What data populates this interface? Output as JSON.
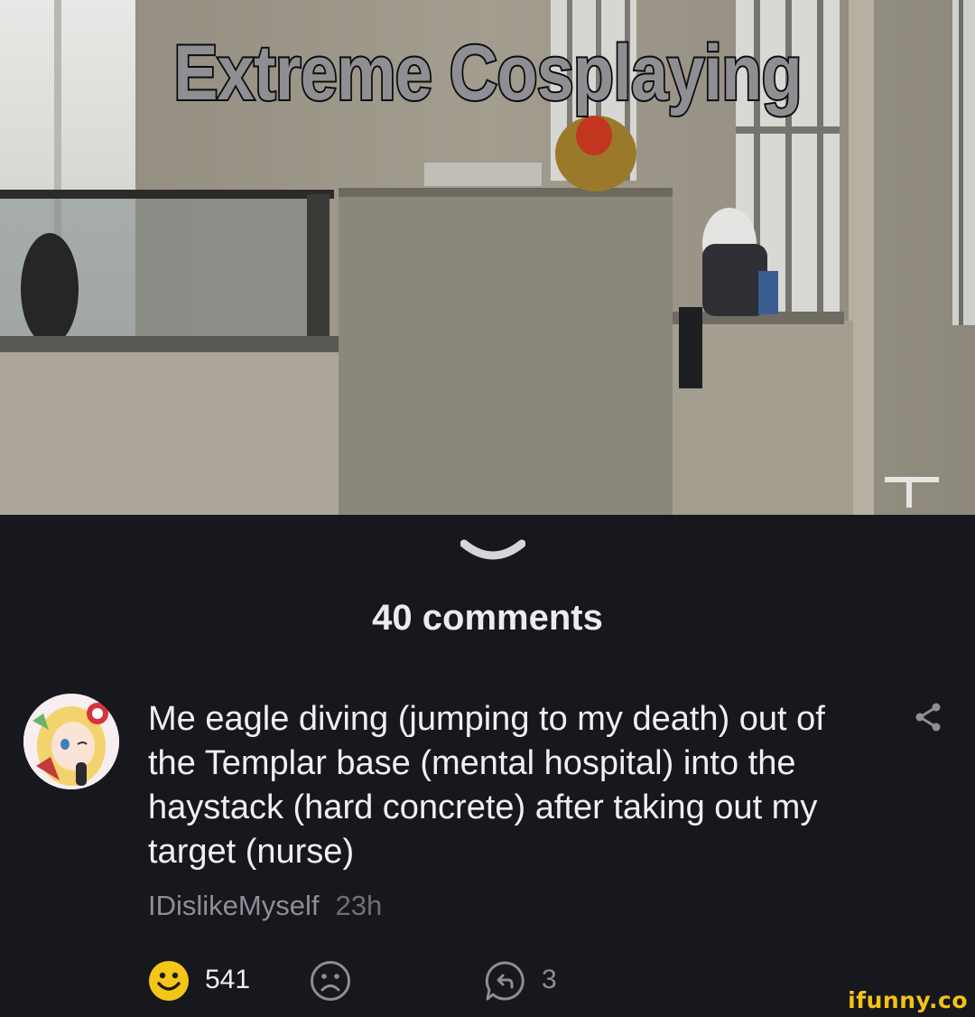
{
  "meme": {
    "caption": "Extreme Cosplaying",
    "image_icon": "photo-placeholder"
  },
  "collapse_icon": "chevron-down-icon",
  "comments_header": {
    "count_label": "40 comments"
  },
  "comment": {
    "avatar_icon": "avatar-anime-girl",
    "text": "Me eagle diving (jumping to my death) out of the Templar base (mental hospital) into the haystack (hard concrete) after taking out my target (nurse)",
    "author": "IDislikeMyself",
    "time": "23h",
    "share_icon": "share-icon",
    "smiles": "541",
    "replies": "3"
  },
  "watermark": "ifunny.co",
  "colors": {
    "background": "#17181d",
    "text_primary": "#f0f0f2",
    "text_secondary": "#8d8e96",
    "smile_yellow": "#f5c518",
    "watermark_yellow": "#f3c217"
  }
}
